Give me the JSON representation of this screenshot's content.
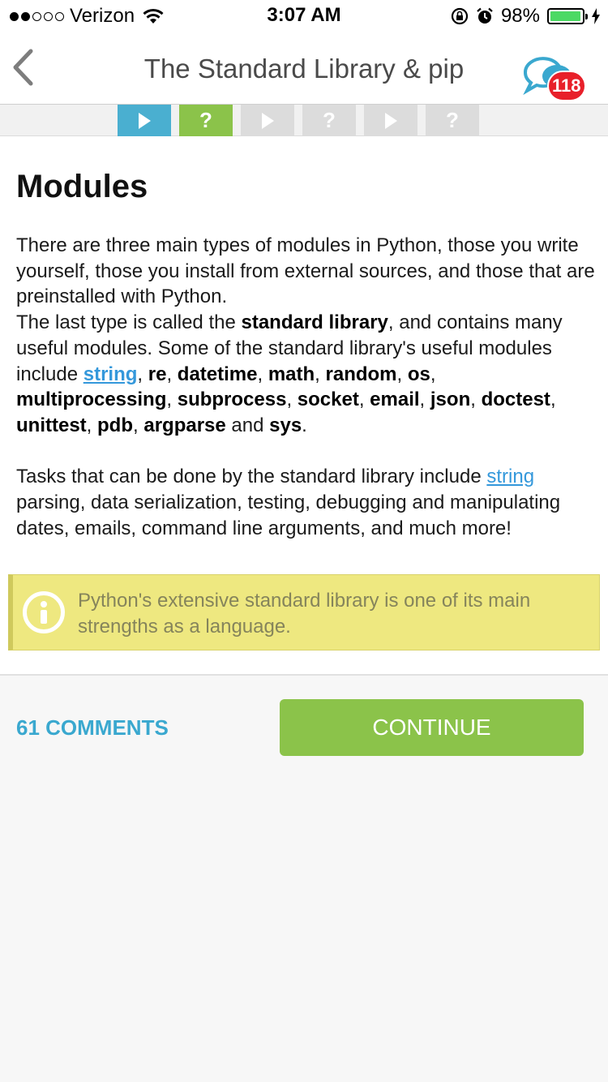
{
  "status_bar": {
    "carrier": "Verizon",
    "time": "3:07 AM",
    "battery": "98%",
    "battery_level": 0.98
  },
  "nav": {
    "title": "The Standard Library & pip",
    "comments_badge": "118"
  },
  "progress_steps": [
    {
      "type": "lesson",
      "state": "active"
    },
    {
      "type": "quiz",
      "label": "?",
      "state": "active"
    },
    {
      "type": "lesson",
      "state": "locked"
    },
    {
      "type": "quiz",
      "label": "?",
      "state": "locked"
    },
    {
      "type": "lesson",
      "state": "locked"
    },
    {
      "type": "quiz",
      "label": "?",
      "state": "locked"
    }
  ],
  "lesson": {
    "heading": "Modules",
    "p1_line1": "There are three main types of modules in Python, those you write yourself, those you install from external sources, and those that are preinstalled with Python.",
    "p1_line2_a": "The last type is called the ",
    "p1_line2_bold": "standard library",
    "p1_line2_b": ", and contains many useful modules. Some of the standard library's useful modules include ",
    "mod_string": "string",
    "mod_re": "re",
    "mod_datetime": "datetime",
    "mod_math": "math",
    "mod_random": "random",
    "mod_os": "os",
    "mod_multiprocessing": "multiprocessing",
    "mod_subprocess": "subprocess",
    "mod_socket": "socket",
    "mod_email": "email",
    "mod_json": "json",
    "mod_doctest": "doctest",
    "mod_unittest": "unittest",
    "mod_pdb": "pdb",
    "mod_argparse": "argparse",
    "word_and": " and ",
    "mod_sys": "sys",
    "sep": ", ",
    "end_period": ".",
    "p2_a": "Tasks that can be done by the standard library include ",
    "p2_link": "string",
    "p2_b": " parsing, data serialization, testing, debugging and manipulating dates, emails, command line arguments, and much more!",
    "tip": "Python's extensive standard library is one of its main strengths as a language."
  },
  "footer": {
    "comments_label": "61 COMMENTS",
    "continue_label": "CONTINUE"
  },
  "colors": {
    "accent_blue": "#4aafd0",
    "accent_green": "#8bc34a",
    "badge_red": "#e8202a",
    "tip_bg": "#eee880"
  }
}
